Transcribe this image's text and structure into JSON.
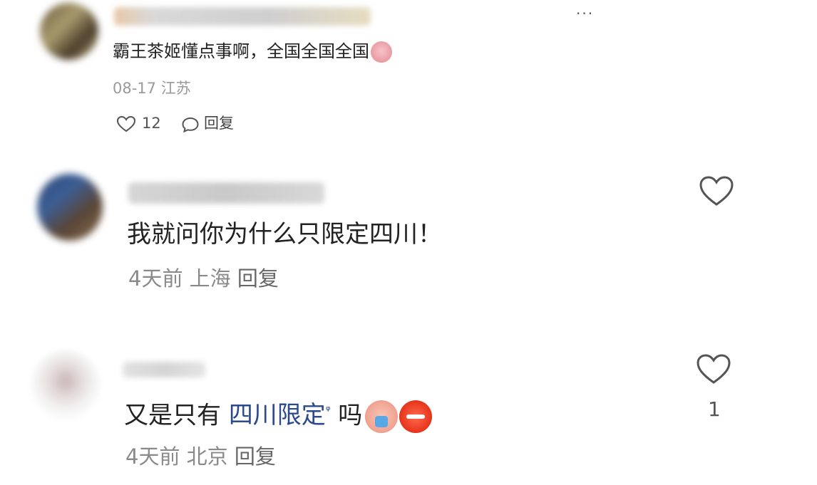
{
  "comments": [
    {
      "text": "霸王茶姬懂点事啊，全国全国全国",
      "date": "08-17",
      "location": "江苏",
      "like_count": "12",
      "reply_label": "回复",
      "more_icon": "more-dots-icon"
    },
    {
      "text": "我就问你为什么只限定四川！",
      "time": "4天前",
      "location": "上海",
      "reply_label": "回复",
      "like_icon": "heart-outline-icon"
    },
    {
      "text_prefix": "又是只有 ",
      "link_text": "四川限定",
      "text_suffix": " 吗",
      "time": "4天前",
      "location": "北京",
      "reply_label": "回复",
      "like_count": "1",
      "like_icon": "heart-outline-icon"
    }
  ],
  "colors": {
    "link": "#2b4a8b",
    "meta": "#8a8a8a",
    "text": "#222222"
  }
}
